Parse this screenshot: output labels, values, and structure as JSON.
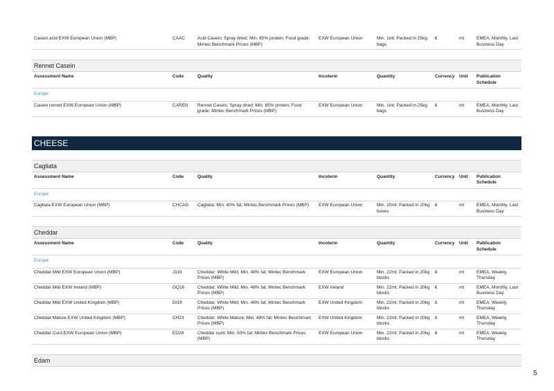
{
  "columns": {
    "name": "Assessment Name",
    "code": "Code",
    "quality": "Quality",
    "incoterm": "Incoterm",
    "quantity": "Quantity",
    "currency": "Currency",
    "unit": "Unit",
    "publication": "Publication Schedule"
  },
  "top_row": {
    "name": "Casein acid EXW European Union (MBP)",
    "code": "CAAC",
    "quality": "Acid Casein; Spray dried; Min. 85% protein; Food grade; Mintec Benchmark Prices (MBP)",
    "incoterm": "EXW European Union",
    "quantity": "Min. 1mt; Packed in 25kg bags",
    "currency": "€",
    "unit": "mt",
    "publication": "EMEA, Monthly, Last Business Day"
  },
  "rennet": {
    "title": "Rennet Casein",
    "region": "Europe",
    "rows": [
      {
        "name": "Casein rennet EXW European Union (MBP)",
        "code": "CAREN",
        "quality": "Rennet Casein; Spray dried; Min. 85% protein; Food grade; Mintec Benchmark Prices (MBP)",
        "incoterm": "EXW European Union",
        "quantity": "Min. 1mt; Packed in 25kg bags",
        "currency": "€",
        "unit": "mt",
        "publication": "EMEA, Monthly, Last Business Day"
      }
    ]
  },
  "category": "CHEESE",
  "cagliata": {
    "title": "Cagliata",
    "region": "Europe",
    "rows": [
      {
        "name": "Cagliata EXW European Union (MBP)",
        "code": "CHCAG",
        "quality": "Cagliata; Min. 40% fat; Mintec Benchmark Prices (MBP)",
        "incoterm": "EXW European Union",
        "quantity": "Min. 20mt; Packed in 20kg boxes",
        "currency": "€",
        "unit": "mt",
        "publication": "EMEA, Monthly, Last Business Day"
      }
    ]
  },
  "cheddar": {
    "title": "Cheddar",
    "region": "Europe",
    "rows": [
      {
        "name": "Cheddar Mild EXW European Union (MBP)",
        "code": "J119",
        "quality": "Cheddar; White Mild; Min. 48% fat; Mintec Benchmark Prices (MBP)",
        "incoterm": "EXW European Union",
        "quantity": "Min. 22mt; Packed in 20kg blocks",
        "currency": "€",
        "unit": "mt",
        "publication": "EMEA, Weekly, Thursday"
      },
      {
        "name": "Cheddar Mild EXW Ireland (MBP)",
        "code": "GQ16",
        "quality": "Cheddar; White Mild; Min. 48% fat; Mintec Benchmark Prices (MBP)",
        "incoterm": "EXW Ireland",
        "quantity": "Min. 22mt; Packed in 20kg blocks",
        "currency": "€",
        "unit": "mt",
        "publication": "EMEA, Monthly, Last Business Day"
      },
      {
        "name": "Cheddar Mild EXW United Kingdom (MBP)",
        "code": "DI19",
        "quality": "Cheddar; White Mild; Min. 48% fat; Mintec Benchmark Prices (MBP)",
        "incoterm": "EXW United Kingdom",
        "quantity": "Min. 22mt; Packed in 20kg blocks",
        "currency": "£",
        "unit": "mt",
        "publication": "EMEA, Weekly, Thursday"
      },
      {
        "name": "Cheddar Mature EXW United Kingdom (MBP)",
        "code": "CH23",
        "quality": "Cheddar; White Mature; Min. 48% fat; Mintec Benchmark Prices (MBP)",
        "incoterm": "EXW United Kingdom",
        "quantity": "Min. 22mt; Packed in 20kg blocks",
        "currency": "£",
        "unit": "mt",
        "publication": "EMEA, Weekly, Thursday"
      },
      {
        "name": "Cheddar Curd EXW European Union (MBP)",
        "code": "ED28",
        "quality": "Cheddar curd; Min. 50% fat; Mintec Benchmark Prices (MBP)",
        "incoterm": "EXW European Union",
        "quantity": "Min. 22mt; Packed in 20kg blocks",
        "currency": "€",
        "unit": "mt",
        "publication": "EMEA, Weekly, Thursday"
      }
    ]
  },
  "edam": {
    "title": "Edam"
  },
  "page_number": "5"
}
